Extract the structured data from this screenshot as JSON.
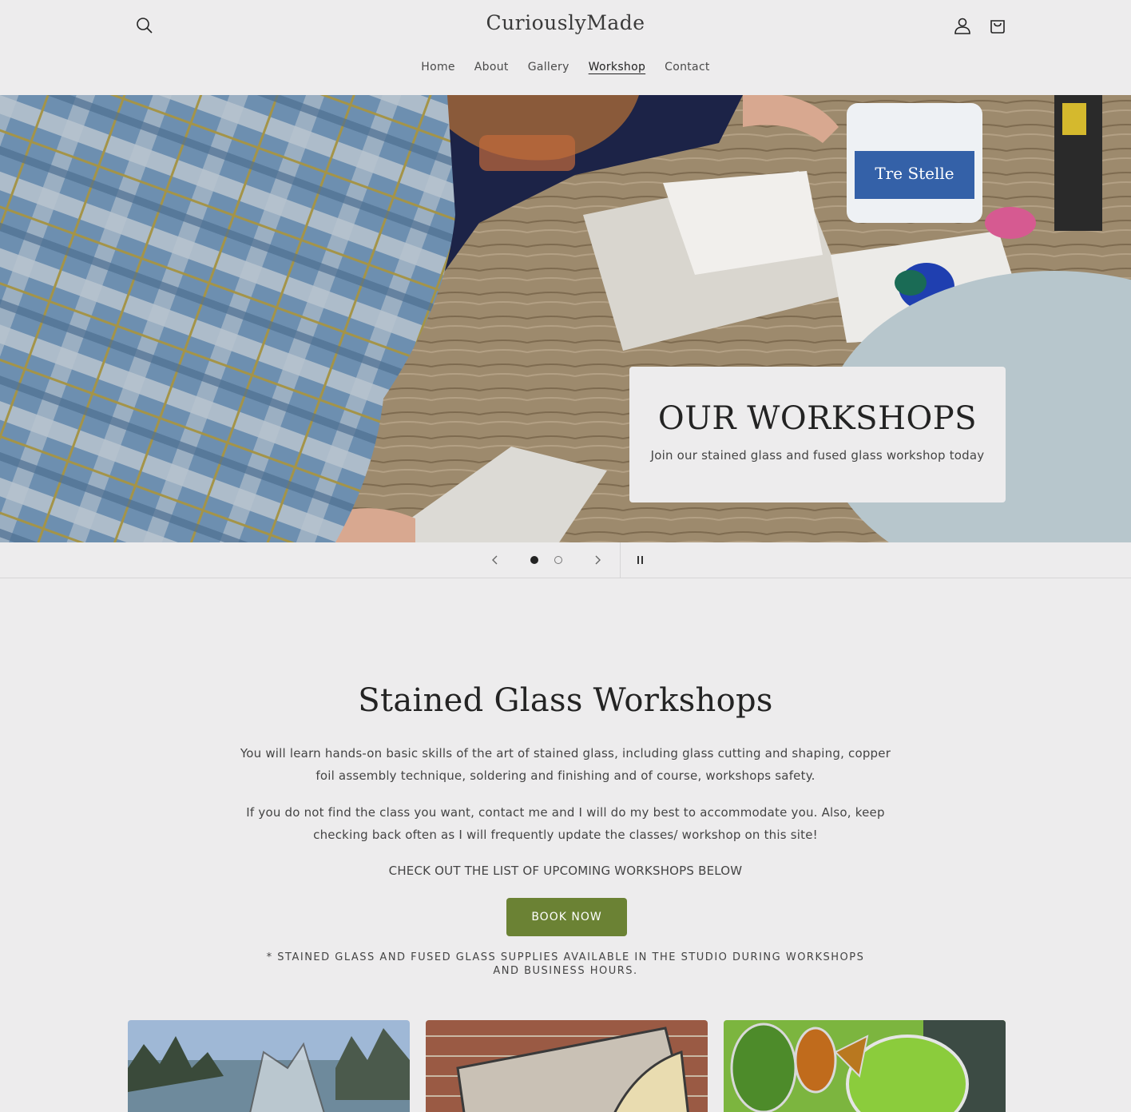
{
  "header": {
    "logo": "CuriouslyMade",
    "icons": [
      "search-icon",
      "account-icon",
      "cart-icon"
    ]
  },
  "nav": {
    "items": [
      {
        "label": "Home",
        "active": false
      },
      {
        "label": "About",
        "active": false
      },
      {
        "label": "Gallery",
        "active": false
      },
      {
        "label": "Workshop",
        "active": true
      },
      {
        "label": "Contact",
        "active": false
      }
    ]
  },
  "hero": {
    "title": "OUR WORKSHOPS",
    "subtitle": "Join our stained glass and fused glass workshop today"
  },
  "slider": {
    "prev_icon": "chevron-left-icon",
    "next_icon": "chevron-right-icon",
    "pause_icon": "pause-icon",
    "slide_count": 2,
    "active_slide": 1
  },
  "content": {
    "title": "Stained Glass Workshops",
    "paragraph1": "You will learn hands-on basic skills of the art of stained glass, including glass cutting and shaping, copper foil assembly technique, soldering and finishing and of course, workshops safety.",
    "paragraph2": "If you do not find the class you want, contact me and I will do my best to accommodate you. Also, keep checking back often as I will frequently update the classes/ workshop on this site!",
    "paragraph3": "CHECK OUT THE LIST OF UPCOMING WORKSHOPS BELOW",
    "book_button": "BOOK NOW",
    "note": "* STAINED GLASS AND FUSED GLASS SUPPLIES AVAILABLE IN THE STUDIO DURING WORKSHOPS AND BUSINESS HOURS."
  },
  "colors": {
    "background": "#edeced",
    "accent": "#6b8234",
    "text": "#232323"
  }
}
